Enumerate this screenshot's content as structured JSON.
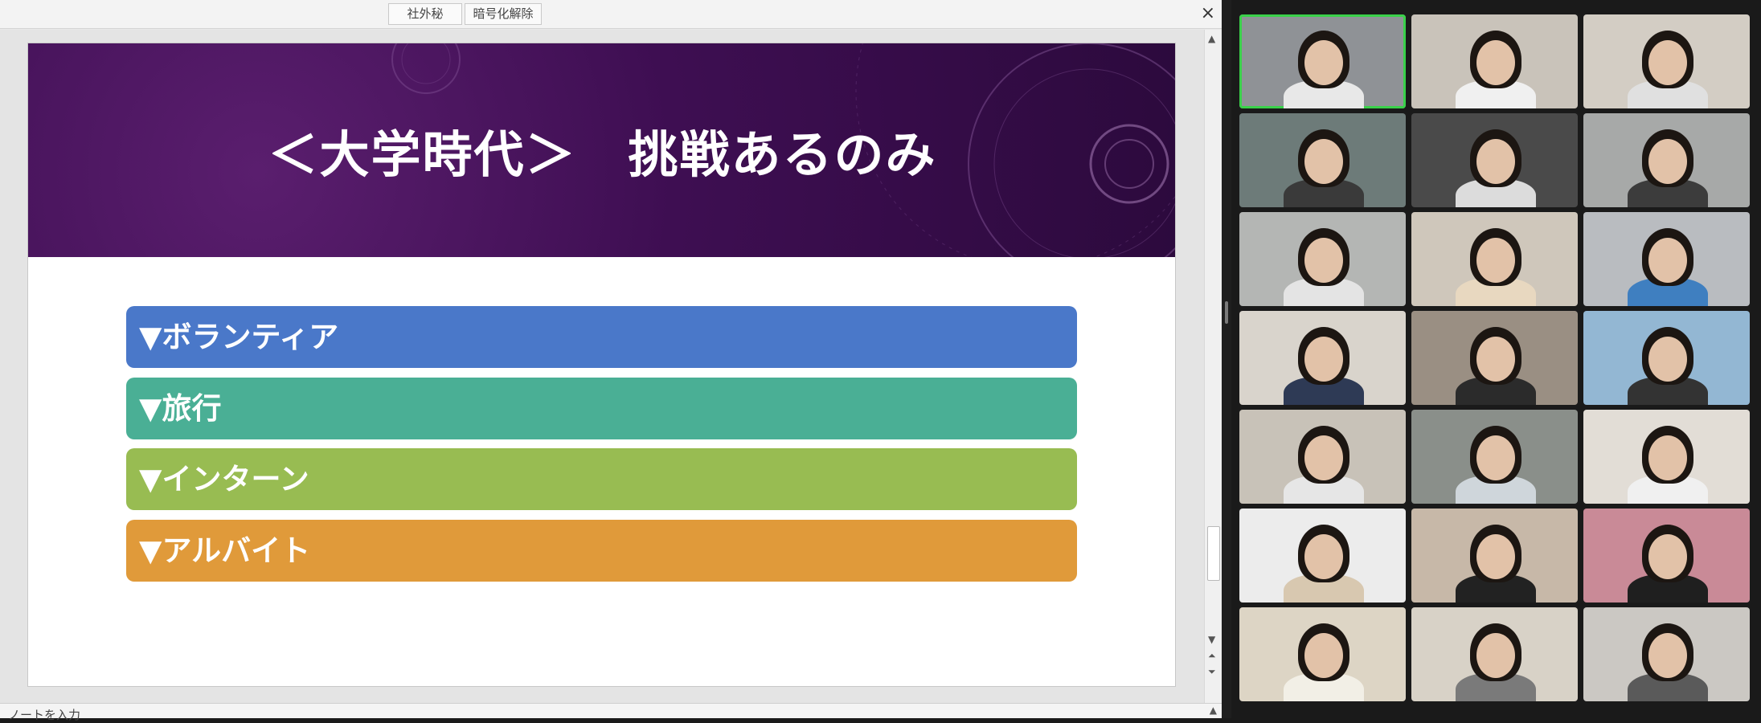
{
  "toolbar": {
    "confidential_label": "社外秘",
    "decrypt_label": "暗号化解除",
    "close_symbol": "×"
  },
  "slide": {
    "title": "＜大学時代＞　挑戦あるのみ",
    "items": [
      {
        "label": "▼ボランティア",
        "color": "#4a78c9"
      },
      {
        "label": "▼旅行",
        "color": "#4aaf95"
      },
      {
        "label": "▼インターン",
        "color": "#98bc52"
      },
      {
        "label": "▼アルバイト",
        "color": "#e09a3a"
      }
    ],
    "banner_color": "#3e0e52"
  },
  "notes": {
    "placeholder": "ノートを入力"
  },
  "scrollbar": {
    "up_icon": "▲",
    "down_icon": "▼",
    "prev_icon": "⏶",
    "next_icon": "⏷"
  },
  "gallery": {
    "active_speaker_color": "#3ad14a",
    "participants": [
      {
        "id": "p1",
        "active": true
      },
      {
        "id": "p2",
        "active": false
      },
      {
        "id": "p3",
        "active": false
      },
      {
        "id": "p4",
        "active": false
      },
      {
        "id": "p5",
        "active": false
      },
      {
        "id": "p6",
        "active": false
      },
      {
        "id": "p7",
        "active": false
      },
      {
        "id": "p8",
        "active": false
      },
      {
        "id": "p9",
        "active": false
      },
      {
        "id": "p10",
        "active": false
      },
      {
        "id": "p11",
        "active": false
      },
      {
        "id": "p12",
        "active": false
      },
      {
        "id": "p13",
        "active": false
      },
      {
        "id": "p14",
        "active": false
      },
      {
        "id": "p15",
        "active": false
      },
      {
        "id": "p16",
        "active": false
      },
      {
        "id": "p17",
        "active": false
      },
      {
        "id": "p18",
        "active": false
      },
      {
        "id": "p19",
        "active": false
      },
      {
        "id": "p20",
        "active": false
      },
      {
        "id": "p21",
        "active": false
      }
    ]
  }
}
